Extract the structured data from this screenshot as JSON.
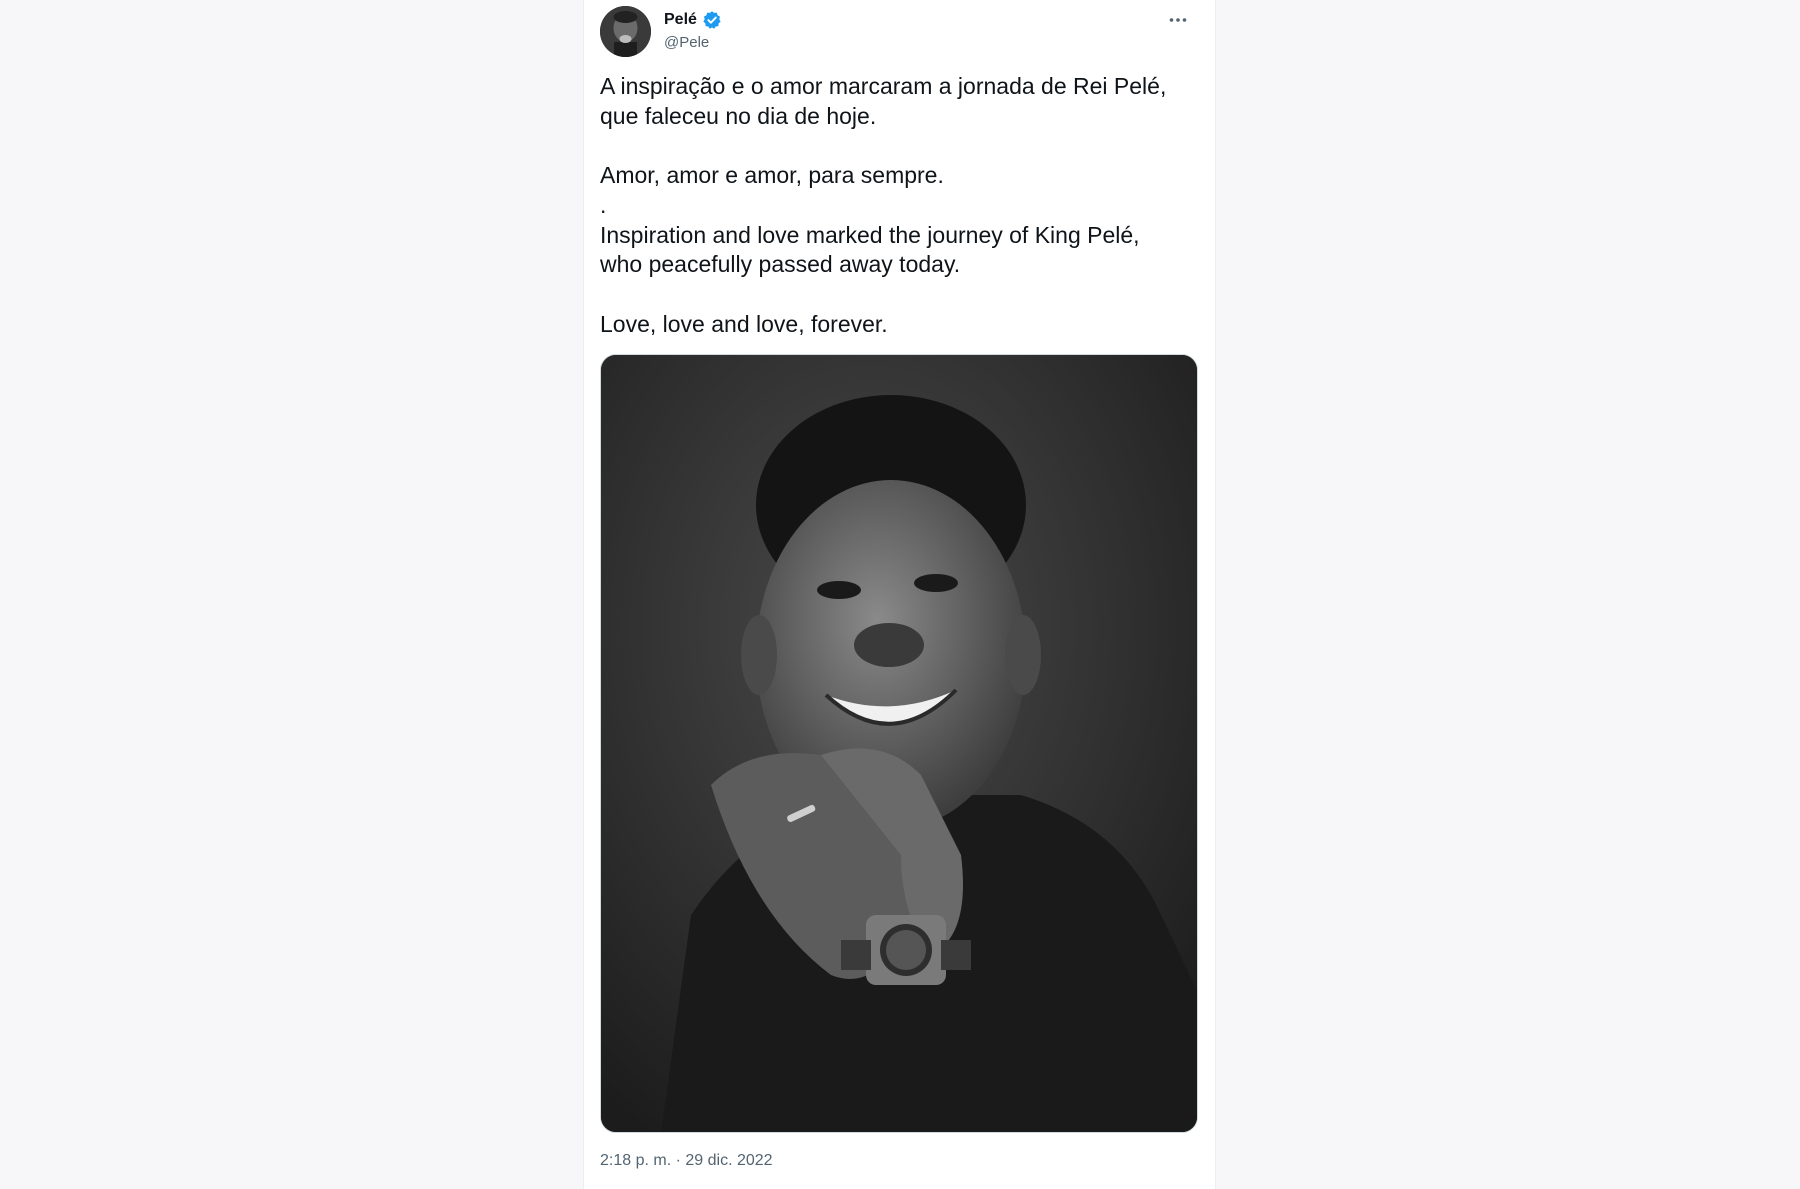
{
  "author": {
    "display_name": "Pelé",
    "handle": "@Pele",
    "verified": true,
    "verified_icon": "verified-badge-icon",
    "avatar_icon": "profile-photo"
  },
  "more_icon": "more-dots-icon",
  "tweet": {
    "text": "A inspiração e o amor marcaram a jornada de Rei Pelé,\nque faleceu no dia de hoje.\n\nAmor, amor e amor, para sempre.\n.\nInspiration and love marked the journey of King Pelé,\nwho peacefully passed away today.\n\nLove, love and love, forever."
  },
  "media": {
    "type": "black-and-white portrait photo"
  },
  "timestamp": "2:18 p. m. · 29 dic. 2022",
  "colors": {
    "verified_blue": "#1d9bf0",
    "text_primary": "#0f1419",
    "text_secondary": "#536471",
    "page_background": "#f7f7fa",
    "card_background": "#ffffff"
  }
}
